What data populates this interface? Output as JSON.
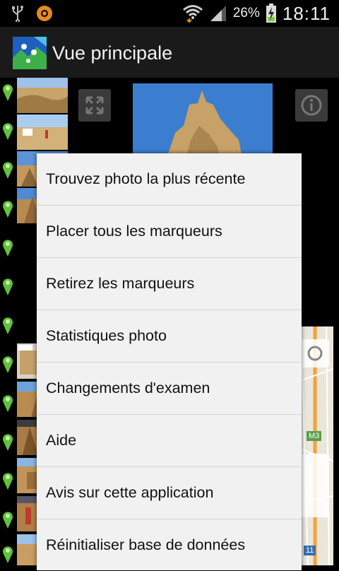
{
  "status_bar": {
    "battery_percent": "26%",
    "time": "18:11",
    "icons": [
      "usb-icon",
      "ring-icon",
      "wifi-icon",
      "signal-icon",
      "battery-charging-icon"
    ]
  },
  "action_bar": {
    "title": "Vue principale",
    "icon": "app-map-icon"
  },
  "map": {
    "road_label": "M3",
    "road_number": "11"
  },
  "menu": {
    "items": [
      {
        "label": "Trouvez photo la plus récente"
      },
      {
        "label": "Placer tous les marqueurs"
      },
      {
        "label": "Retirez les marqueurs"
      },
      {
        "label": "Statistiques photo"
      },
      {
        "label": "Changements d'examen"
      },
      {
        "label": "Aide"
      },
      {
        "label": "Avis sur cette application"
      },
      {
        "label": "Réinitialiser base de données"
      }
    ]
  },
  "colors": {
    "menu_bg": "#f1f1f1",
    "pin_green": "#5fc23a",
    "map_road": "#f2a23a"
  }
}
